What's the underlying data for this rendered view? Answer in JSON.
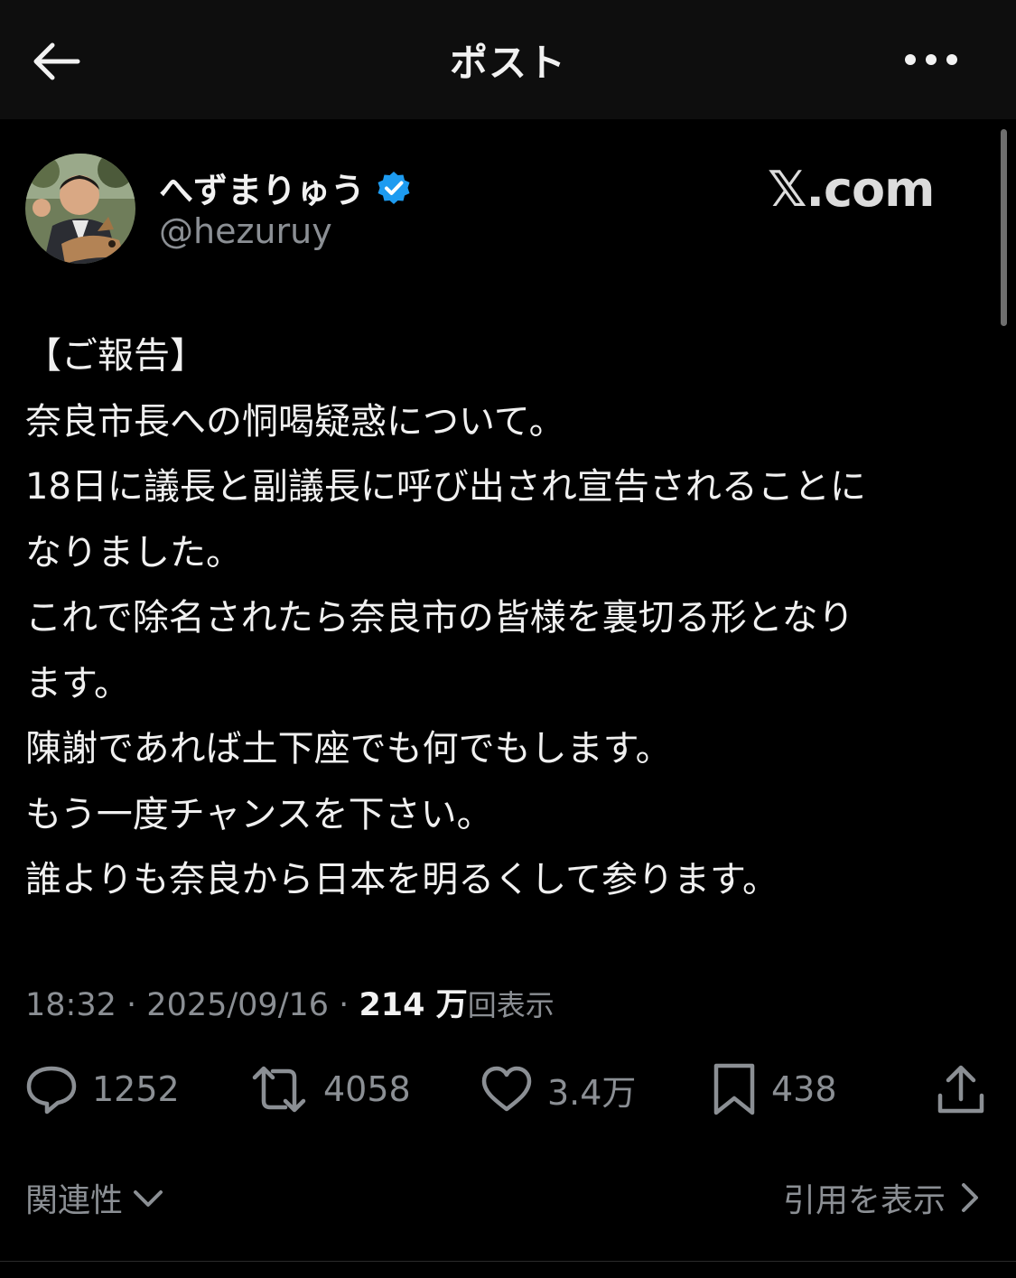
{
  "header": {
    "title": "ポスト",
    "back_icon": "arrow-left-icon",
    "more_icon": "more-horizontal-icon"
  },
  "author": {
    "name": "へずまりゅう",
    "handle": "@hezuruy",
    "verified": true,
    "verified_color": "#1d9bf0"
  },
  "source_mark": "𝕏.com",
  "post": {
    "lines": [
      "【ご報告】",
      "奈良市長への恫喝疑惑について。",
      "18日に議長と副議長に呼び出され宣告されることに",
      "なりました。",
      "これで除名されたら奈良市の皆様を裏切る形となり",
      "ます。",
      "陳謝であれば土下座でも何でもします。",
      "もう一度チャンスを下さい。",
      "誰よりも奈良から日本を明るくして参ります。"
    ]
  },
  "meta": {
    "time": "18:32",
    "separator": "·",
    "date": "2025/09/16",
    "views_count": "214 万",
    "views_label": "回表示"
  },
  "actions": {
    "replies": "1252",
    "reposts": "4058",
    "likes": "3.4万",
    "bookmarks": "438"
  },
  "footer": {
    "left_label": "関連性",
    "right_label": "引用を表示"
  },
  "colors": {
    "background": "#000000",
    "header_bg": "#0e0e0e",
    "text": "#f0f0f0",
    "muted": "#8b8f94",
    "accent": "#1d9bf0"
  }
}
